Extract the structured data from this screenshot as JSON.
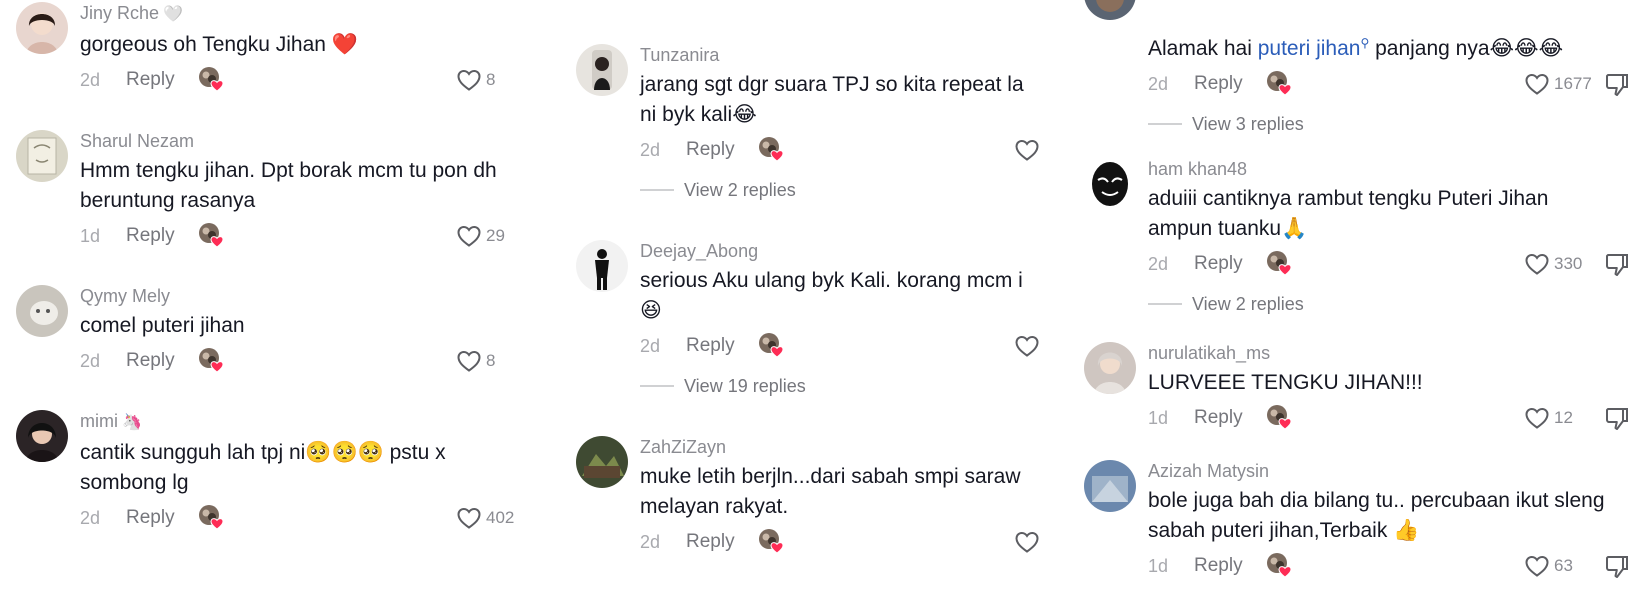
{
  "panel1": {
    "comments": [
      {
        "username": "Jiny Rche",
        "username_emoji": "🤍",
        "text": "gorgeous oh Tengku Jihan ❤️",
        "time": "2d",
        "reply": "Reply",
        "likes": "8"
      },
      {
        "username": "Sharul Nezam",
        "text": "Hmm tengku jihan. Dpt borak mcm tu pon dh\nberuntung rasanya",
        "time": "1d",
        "reply": "Reply",
        "likes": "29"
      },
      {
        "username": "Qymy Mely",
        "text": "comel puteri jihan",
        "time": "2d",
        "reply": "Reply",
        "likes": "8"
      },
      {
        "username": "mimi",
        "username_emoji": "🦄",
        "text": "cantik sungguh lah tpj ni🥺🥺🥺 pstu x\nsombong lg",
        "time": "2d",
        "reply": "Reply",
        "likes": "402"
      }
    ]
  },
  "panel2": {
    "comments": [
      {
        "username": "Tunzanira",
        "text": "jarang sgt dgr suara TPJ so kita repeat la\nni byk kali😂",
        "time": "2d",
        "reply": "Reply",
        "view_replies": "View 2 replies"
      },
      {
        "username": "Deejay_Abong",
        "text": "serious Aku ulang byk Kali. korang mcm i\n😆",
        "time": "2d",
        "reply": "Reply",
        "view_replies": "View 19 replies"
      },
      {
        "username": "ZahZiZayn",
        "text": "muke letih berjln...dari sabah smpi saraw\nmelayan rakyat.",
        "time": "2d",
        "reply": "Reply"
      }
    ]
  },
  "panel3": {
    "comments": [
      {
        "text_before": "Alamak hai ",
        "mention": "puteri jihan",
        "text_after": " panjang nya😂😂😂",
        "time": "2d",
        "reply": "Reply",
        "likes": "1677",
        "view_replies": "View 3 replies"
      },
      {
        "username": "ham khan48",
        "text": "aduiii cantiknya rambut tengku Puteri Jihan\nampun tuanku🙏",
        "time": "2d",
        "reply": "Reply",
        "likes": "330",
        "view_replies": "View 2 replies"
      },
      {
        "username": "nurulatikah_ms",
        "text": "LURVEEE TENGKU JIHAN!!!",
        "time": "1d",
        "reply": "Reply",
        "likes": "12"
      },
      {
        "username": "Azizah Matysin",
        "text": "bole juga bah dia bilang tu.. percubaan ikut sleng\nsabah puteri jihan,Terbaik 👍",
        "time": "1d",
        "reply": "Reply",
        "likes": "63"
      }
    ]
  },
  "colors": {
    "mention": "#2b5db9",
    "meta": "#8a8b91",
    "text": "#161823",
    "creator_heart": "#fe2c55"
  }
}
